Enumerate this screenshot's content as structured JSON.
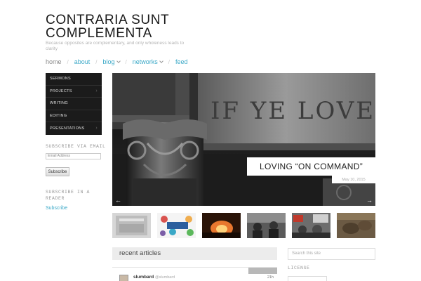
{
  "site": {
    "title": "CONTRARIA SUNT COMPLEMENTA",
    "tagline": "Because opposites are complementary, and only wholeness leads to clarity"
  },
  "nav": [
    {
      "label": "home",
      "has_caret": false
    },
    {
      "label": "about",
      "has_caret": false
    },
    {
      "label": "blog",
      "has_caret": true
    },
    {
      "label": "networks",
      "has_caret": true
    },
    {
      "label": "feed",
      "has_caret": false
    }
  ],
  "sidemenu": [
    {
      "label": "SERMONS",
      "arrow": false
    },
    {
      "label": "PROJECTS",
      "arrow": true
    },
    {
      "label": "WRITING",
      "arrow": false
    },
    {
      "label": "EDITING",
      "arrow": false
    },
    {
      "label": "PRESENTATIONS",
      "arrow": true
    }
  ],
  "subscribe_email": {
    "heading": "SUBSCRIBE VIA EMAIL",
    "placeholder": "Email Address",
    "button": "Subscribe"
  },
  "subscribe_reader": {
    "heading_line1": "SUBSCRIBE IN A",
    "heading_line2": "READER",
    "link": "Subscribe"
  },
  "slider": {
    "carved_text": "IF YE LOVE ME",
    "caption": "LOVING “ON COMMAND”",
    "date": "May 10, 2015",
    "prev_arrow": "←",
    "next_arrow": "→"
  },
  "recent": {
    "heading": "recent articles"
  },
  "tweet": {
    "name": "slumbard",
    "handle": "@slumbard",
    "time": "21h"
  },
  "search": {
    "placeholder": "Search this site"
  },
  "license": {
    "heading": "LICENSE"
  },
  "colors": {
    "accent": "#3aa8c7",
    "menu_bg": "#1b1b1b"
  }
}
